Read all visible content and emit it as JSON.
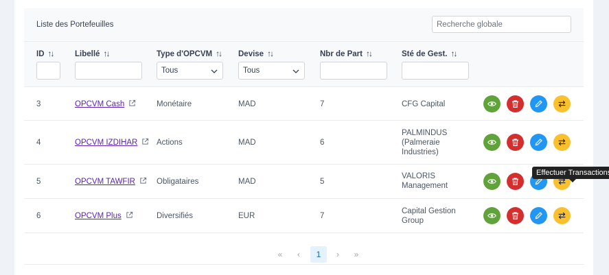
{
  "table": {
    "title": "Liste des Portefeuilles",
    "search_placeholder": "Recherche globale",
    "columns": [
      {
        "label": "ID"
      },
      {
        "label": "Libellé"
      },
      {
        "label": "Type d'OPCVM"
      },
      {
        "label": "Devise"
      },
      {
        "label": "Nbr de Part"
      },
      {
        "label": "Sté de Gest."
      }
    ],
    "filters": {
      "type_value": "Tous",
      "devise_value": "Tous"
    },
    "rows": [
      {
        "id": "3",
        "libelle": "OPCVM Cash",
        "type": "Monétaire",
        "devise": "MAD",
        "parts": "7",
        "gestion_lines": [
          "CFG Capital"
        ]
      },
      {
        "id": "4",
        "libelle": "OPCVM IZDIHAR",
        "type": "Actions",
        "devise": "MAD",
        "parts": "6",
        "gestion_lines": [
          "PALMINDUS",
          "(Palmeraie",
          "Industries)"
        ]
      },
      {
        "id": "5",
        "libelle": "OPCVM TAWFIR",
        "type": "Obligataires",
        "devise": "MAD",
        "parts": "5",
        "gestion_lines": [
          "VALORIS",
          "Management"
        ]
      },
      {
        "id": "6",
        "libelle": "OPCVM Plus",
        "type": "Diversifiés",
        "devise": "EUR",
        "parts": "7",
        "gestion_lines": [
          "Capital Gestion",
          "Group"
        ]
      }
    ],
    "row_actions": [
      {
        "name": "view-button",
        "icon": "eye-icon",
        "color": "#60a33a"
      },
      {
        "name": "delete-button",
        "icon": "trash-icon",
        "color": "#d32f2f"
      },
      {
        "name": "edit-button",
        "icon": "pencil-icon",
        "color": "#2196f3"
      },
      {
        "name": "transactions-button",
        "icon": "transfer-icon",
        "color": "#fbc02d"
      }
    ],
    "tooltip": "Effectuer Transactions",
    "sort_icon": "↑↓"
  },
  "paginator": {
    "first": "«",
    "prev": "‹",
    "current_page": "1",
    "next": "›",
    "last": "»"
  }
}
